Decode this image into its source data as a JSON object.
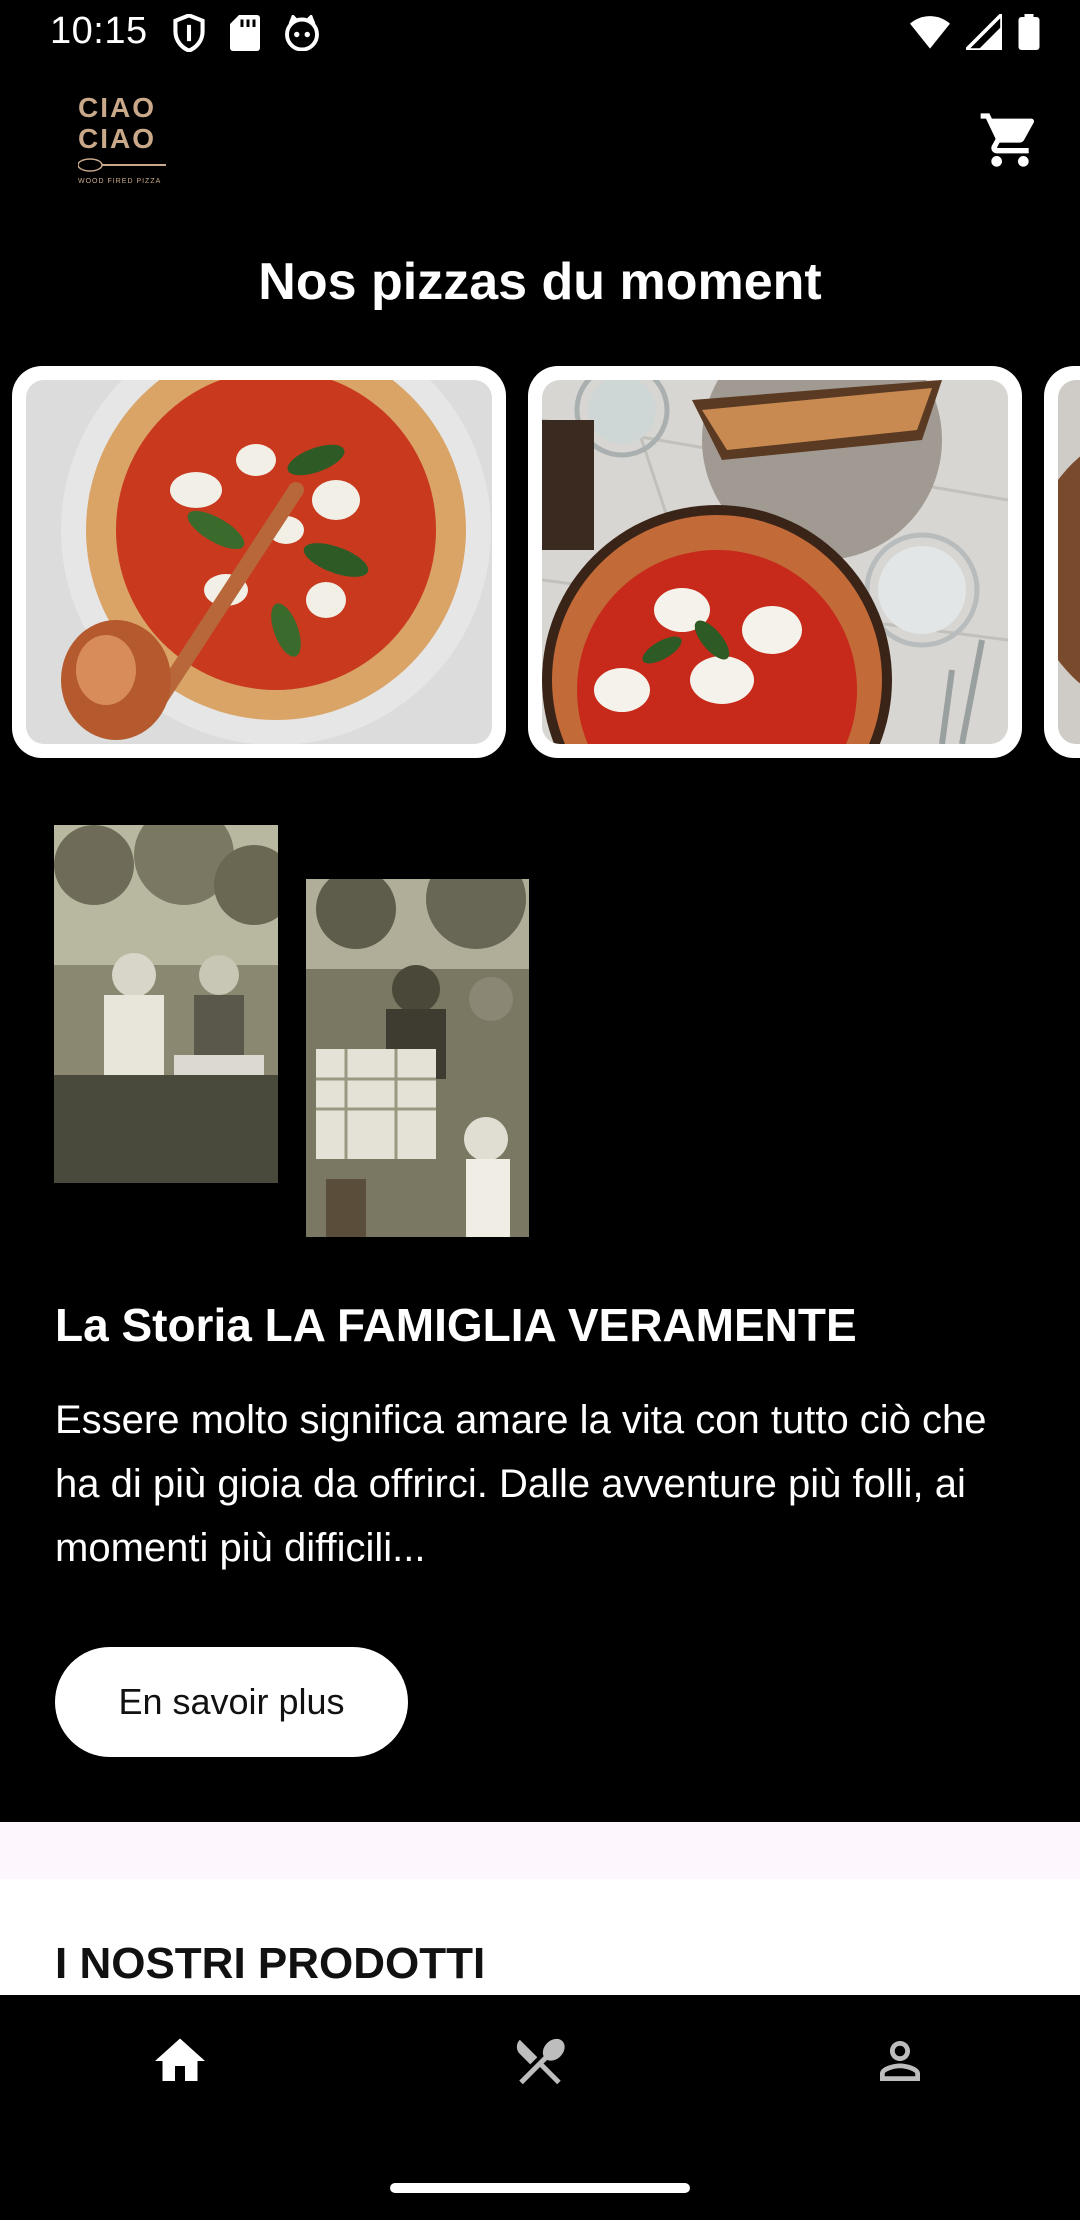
{
  "status_bar": {
    "time": "10:15",
    "left_icons": [
      "shield-icon",
      "sd-card-icon",
      "cat-face-icon"
    ],
    "right_icons": [
      "wifi-icon",
      "signal-icon",
      "battery-icon"
    ]
  },
  "header": {
    "logo_line1": "CIAO",
    "logo_line2": "CIAO",
    "logo_sub": "WOOD FIRED PIZZA",
    "cart_icon": "cart-icon"
  },
  "carousel": {
    "title": "Nos pizzas du moment"
  },
  "story": {
    "title": "La Storia LA FAMIGLIA VERAMENTE",
    "text": "Essere molto significa amare la vita con tutto ciò che ha di più gioia da offrirci. Dalle avventure più folli, ai momenti più difficili...",
    "button_label": "En savoir plus"
  },
  "products": {
    "title": "I NOSTRI PRODOTTI"
  },
  "bottom_nav": {
    "items": [
      "home-icon",
      "utensils-icon",
      "account-icon"
    ],
    "active": "home-icon"
  },
  "colors": {
    "background": "#000000",
    "logo_gold": "#c9a98a",
    "lavender": "#fdf6fc"
  }
}
